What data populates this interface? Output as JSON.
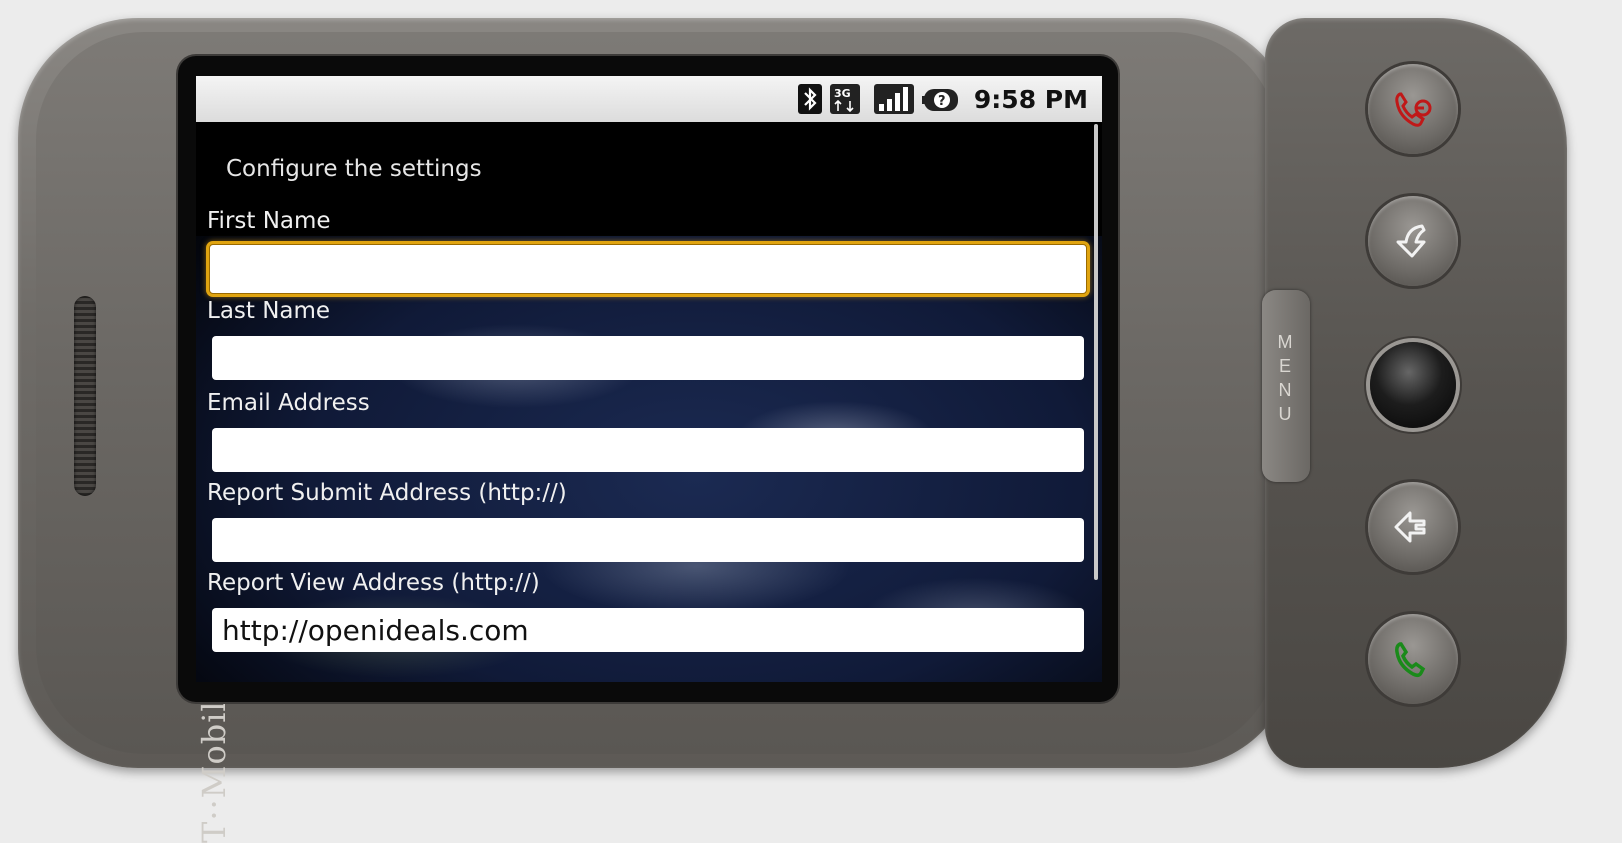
{
  "device": {
    "brand": "T··Mobile·",
    "menu_label": [
      "M",
      "E",
      "N",
      "U"
    ]
  },
  "statusbar": {
    "icons": [
      "bluetooth-icon",
      "3g-data-icon",
      "signal-strength-icon",
      "unknown-battery-icon"
    ],
    "time": "9:58 PM"
  },
  "form": {
    "heading": "Configure the settings",
    "fields": [
      {
        "label": "First Name",
        "value": ""
      },
      {
        "label": "Last Name",
        "value": ""
      },
      {
        "label": "Email Address",
        "value": ""
      },
      {
        "label": "Report Submit Address (http://)",
        "value": ""
      },
      {
        "label": "Report View Address (http://)",
        "value": "http://openideals.com"
      }
    ]
  },
  "buttons": {
    "end_call": "end-call-icon",
    "home": "home-icon",
    "back": "back-icon",
    "call": "call-icon"
  },
  "colors": {
    "focus_ring": "#e0a410",
    "end_call": "#c01818",
    "call": "#1a8a1a"
  }
}
